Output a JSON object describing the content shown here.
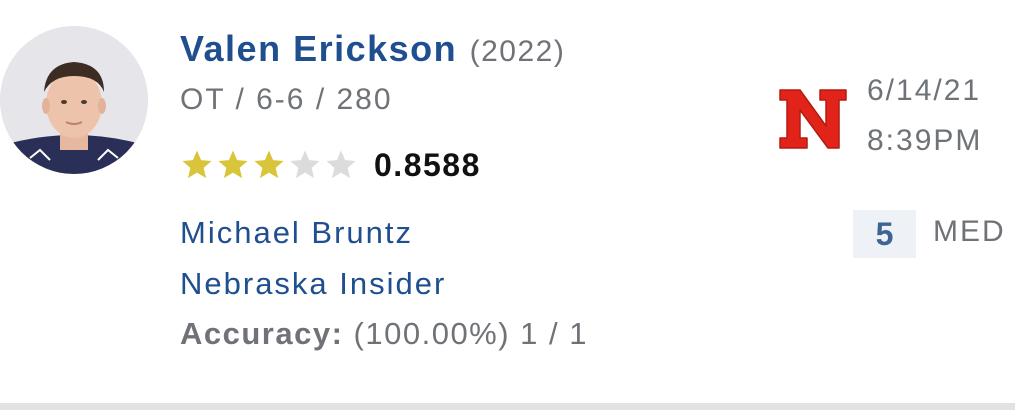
{
  "player": {
    "name": "Valen Erickson",
    "class_year": "(2022)",
    "meta": "OT / 6-6 / 280",
    "stars_filled": 3,
    "stars_total": 5,
    "rating": "0.8588",
    "avatar": "player-headshot-photo"
  },
  "prediction": {
    "team_logo": "nebraska-n-logo",
    "team_logo_letter": "N",
    "date": "6/14/21",
    "time": "8:39PM",
    "confidence_value": "5",
    "confidence_label": "MED"
  },
  "analyst": {
    "name": "Michael Bruntz",
    "role": "Nebraska Insider",
    "accuracy_label": "Accuracy:",
    "accuracy_value": "(100.00%) 1 / 1"
  },
  "colors": {
    "name_blue": "#1f4f8e",
    "meta_gray": "#6f7378",
    "star_gold": "#d9c53a",
    "star_empty": "#dcdcdc",
    "nebraska_red": "#e2231a",
    "badge_bg": "#eef1f5"
  }
}
